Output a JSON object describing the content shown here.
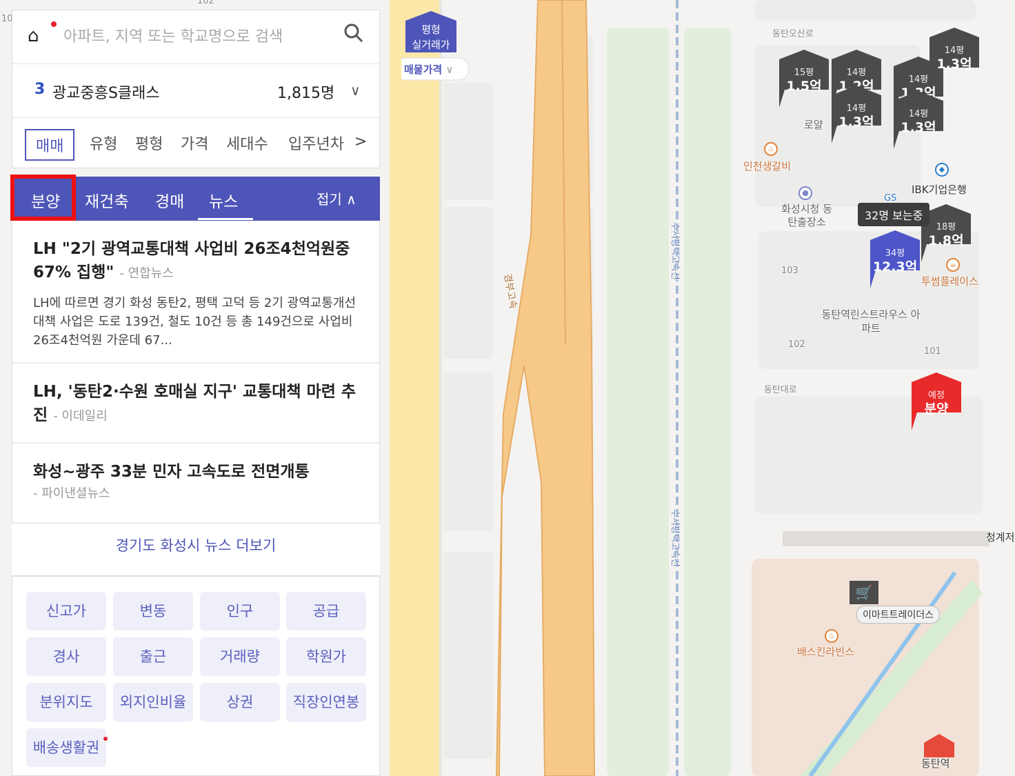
{
  "search": {
    "placeholder": "아파트, 지역 또는 학교명으로 검색"
  },
  "region": {
    "rank": "3",
    "name": "광교중흥S클래스",
    "count": "1,815명"
  },
  "filters": [
    "매매",
    "유형",
    "평형",
    "가격",
    "세대수",
    "입주년차"
  ],
  "tabs": {
    "items": [
      "분양",
      "재건축",
      "경매",
      "뉴스"
    ],
    "active": "뉴스",
    "highlighted": "분양",
    "fold": "접기"
  },
  "news": [
    {
      "title": "LH \"2기 광역교통대책 사업비 26조4천억원중 67% 집행\"",
      "source": "- 연합뉴스",
      "summary": "LH에 따르면 경기 화성 동탄2, 평택 고덕 등 2기 광역교통개선대책 사업은 도로 139건, 철도 10건 등 총 149건으로 사업비 26조4천억원 가운데 67..."
    },
    {
      "title": "LH, '동탄2·수원 호매실 지구' 교통대책 마련 추진",
      "source": "- 이데일리",
      "summary": ""
    },
    {
      "title": "화성~광주 33분 민자 고속도로 전면개통",
      "source": "- 파이낸셜뉴스",
      "summary": ""
    }
  ],
  "more_news": "경기도 화성시 뉴스 더보기",
  "quick_buttons": [
    "신고가",
    "변동",
    "인구",
    "공급",
    "경사",
    "출근",
    "거래량",
    "학원가",
    "분위지도",
    "외지인비율",
    "상권",
    "직장인연봉",
    "배송생활권"
  ],
  "map_header": {
    "line1": "평형",
    "line2": "실거래가",
    "dropdown": "매물가격"
  },
  "markers": [
    {
      "size": "15평",
      "price": "1.5억",
      "color": "#4b4b4b"
    },
    {
      "size": "14평",
      "price": "1.2억",
      "color": "#4b4b4b"
    },
    {
      "size": "14평",
      "price": "1.3억",
      "color": "#4b4b4b"
    },
    {
      "size": "14평",
      "price": "1.3억",
      "color": "#4b4b4b"
    },
    {
      "size": "14평",
      "price": "1.3억",
      "color": "#4b4b4b"
    },
    {
      "size": "14평",
      "price": "1.3억",
      "color": "#4b4b4b"
    },
    {
      "size": "18평",
      "price": "1.8억",
      "color": "#4b4b4b"
    },
    {
      "size": "34평",
      "price": "12.3억",
      "color": "#4d55c9"
    },
    {
      "size": "예정",
      "price": "분양",
      "color": "#e82a2a"
    }
  ],
  "viewers_bubble": "32명 보는중",
  "map_labels": {
    "road_top": "동탄오산로",
    "restaurant1": "인천생갈비",
    "bank": "IBK기업은행",
    "office": "화성시청 동탄출장소",
    "twosome": "투썸플레이스",
    "apt": "동탄역린스트라우스 아파트",
    "dong103": "103",
    "dong102": "102",
    "dong101": "101",
    "road2": "동탄대로",
    "highway": "경부고속",
    "rail1": "수서평택고속선",
    "store": "이마트트레이더스",
    "baskin": "배스킨라빈스",
    "station": "동탄역",
    "royal": "로얄",
    "cheonggye": "청계저",
    "gs": "GS",
    "top_num": "102",
    "left_num": "10"
  }
}
